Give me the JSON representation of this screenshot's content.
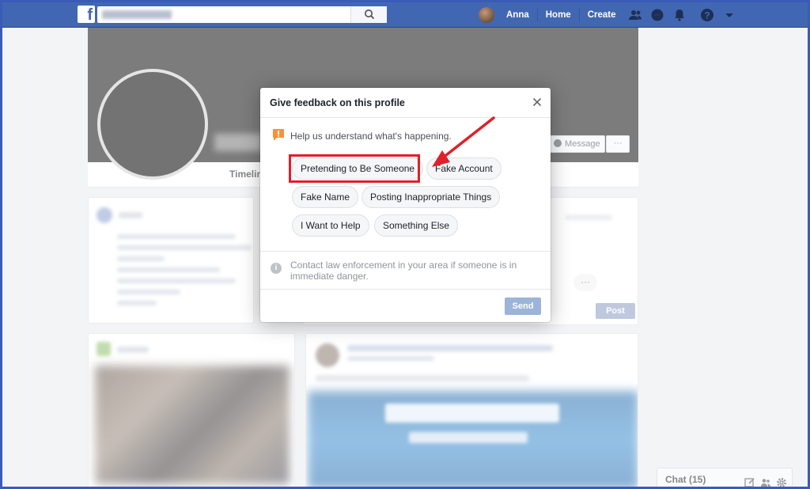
{
  "nav": {
    "user_name": "Anna",
    "home_label": "Home",
    "create_label": "Create"
  },
  "profile": {
    "timeline_tab": "Timelin",
    "message_label": "Message",
    "more_label": "···"
  },
  "dialog": {
    "title": "Give feedback on this profile",
    "prompt": "Help us understand what's happening.",
    "options": [
      "Pretending to Be Someone",
      "Fake Account",
      "Fake Name",
      "Posting Inappropriate Things",
      "I Want to Help",
      "Something Else"
    ],
    "info_text": "Contact law enforcement in your area if someone is in immediate danger.",
    "send_label": "Send"
  },
  "composer": {
    "post_label": "Post",
    "more_label": "···"
  },
  "chat": {
    "label": "Chat (15)"
  },
  "colors": {
    "nav_blue": "#4267b2",
    "highlight_red": "#e0202a",
    "send_disabled": "#9cb4d8"
  }
}
